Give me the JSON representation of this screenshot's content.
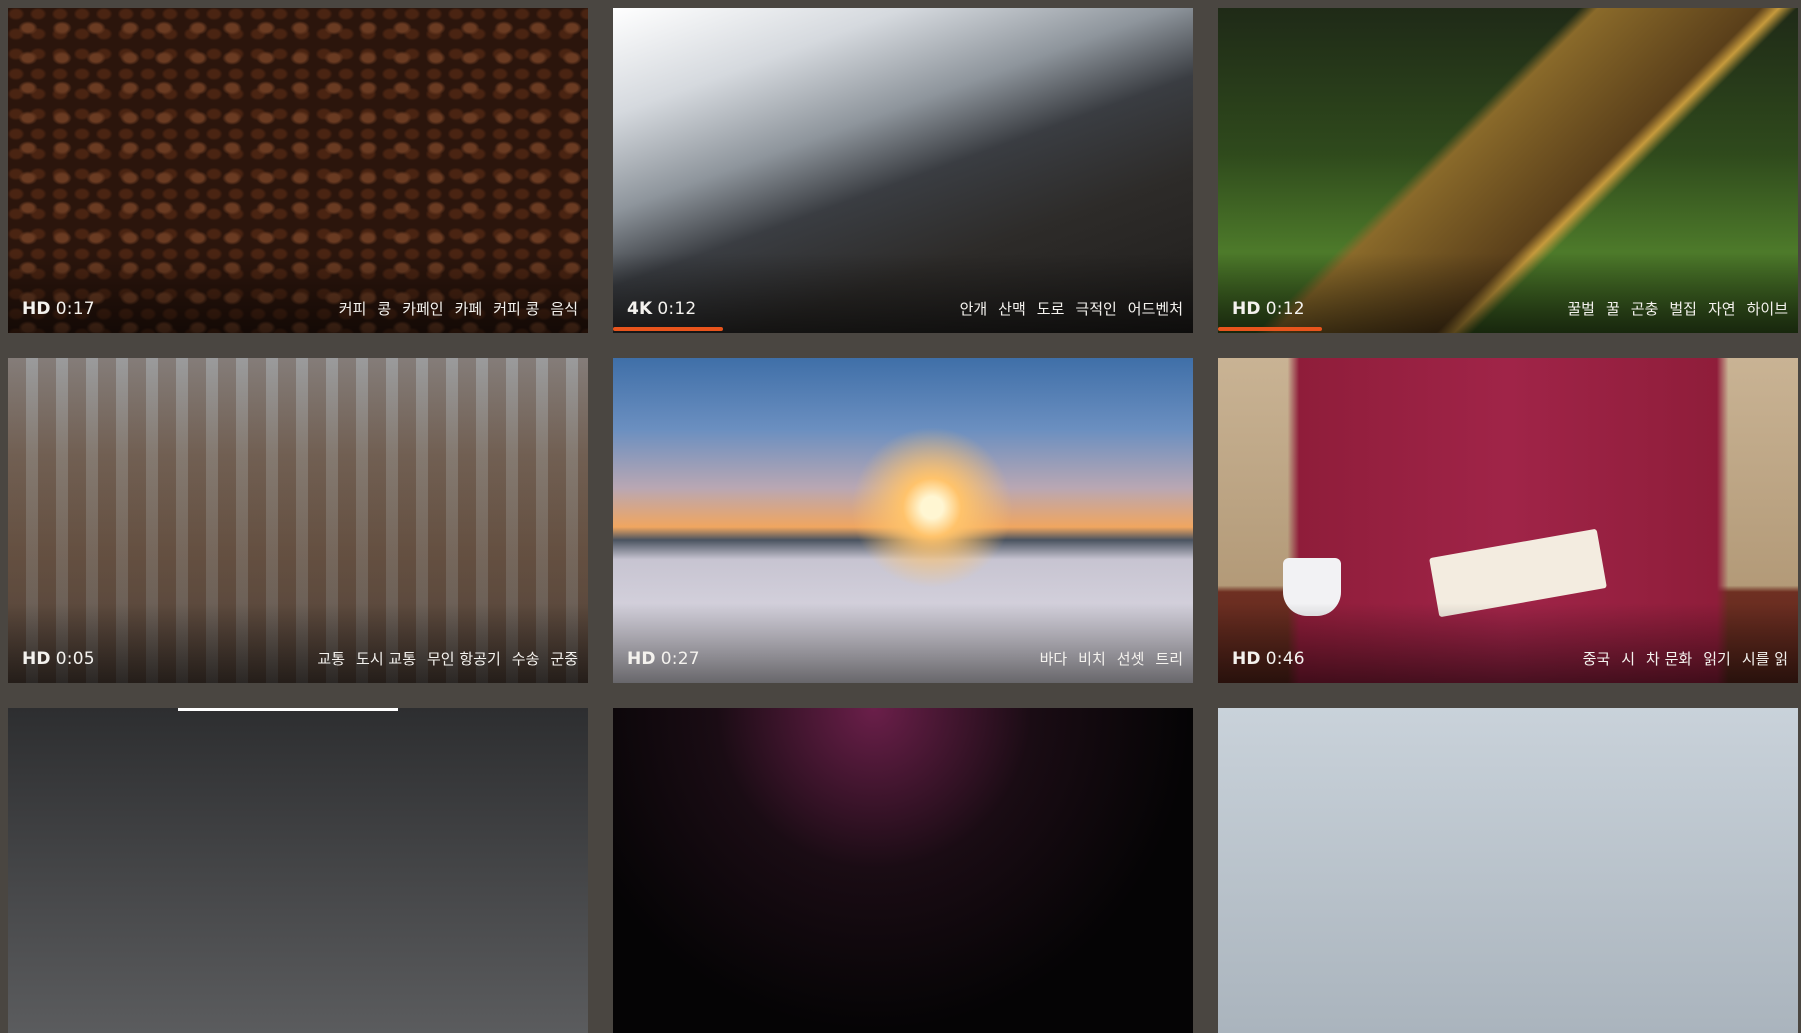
{
  "cards": [
    {
      "quality": "HD",
      "duration": "0:17",
      "tags": [
        "커피",
        "콩",
        "카페인",
        "카페",
        "커피 콩",
        "음식"
      ]
    },
    {
      "quality": "4K",
      "duration": "0:12",
      "tags": [
        "안개",
        "산맥",
        "도로",
        "극적인",
        "어드벤처"
      ],
      "progress": 0.19
    },
    {
      "quality": "HD",
      "duration": "0:12",
      "tags": [
        "꿀벌",
        "꿀",
        "곤충",
        "벌집",
        "자연",
        "하이브"
      ],
      "progress": 0.18
    },
    {
      "quality": "HD",
      "duration": "0:05",
      "tags": [
        "교통",
        "도시 교통",
        "무인 항공기",
        "수송",
        "군중"
      ]
    },
    {
      "quality": "HD",
      "duration": "0:27",
      "tags": [
        "바다",
        "비치",
        "선셋",
        "트리"
      ]
    },
    {
      "quality": "HD",
      "duration": "0:46",
      "tags": [
        "중국",
        "시",
        "차 문화",
        "읽기",
        "시를 읽"
      ]
    },
    {},
    {},
    {}
  ],
  "colors": {
    "background": "#4a4641",
    "progress_accent": "#e8541c",
    "text": "#f4f2ee"
  }
}
